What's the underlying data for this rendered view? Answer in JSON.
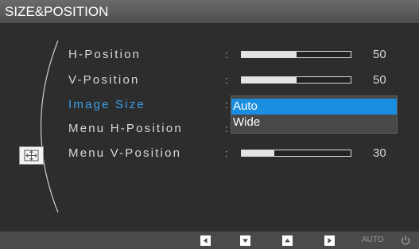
{
  "title": "SIZE&POSITION",
  "menu": {
    "items": [
      {
        "label": "H-Position",
        "value": "50",
        "level": 0.5,
        "active": false
      },
      {
        "label": "V-Position",
        "value": "50",
        "level": 0.5,
        "active": false
      },
      {
        "label": "Image Size",
        "active": true
      },
      {
        "label": "Menu H-Position",
        "active": false
      },
      {
        "label": "Menu V-Position",
        "value": "30",
        "level": 0.3,
        "active": false
      }
    ],
    "separator": ":"
  },
  "dropdown": {
    "options": [
      "Auto",
      "Wide"
    ],
    "selected": "Auto"
  },
  "bottom_bar": {
    "buttons": [
      "left-arrow-icon",
      "down-arrow-icon",
      "up-arrow-icon",
      "enter-icon"
    ],
    "auto_label": "AUTO",
    "power_icon": "power-icon"
  },
  "colors": {
    "accent": "#3aa0e8",
    "highlight": "#1a8fe0",
    "background": "#2d2d2d"
  }
}
